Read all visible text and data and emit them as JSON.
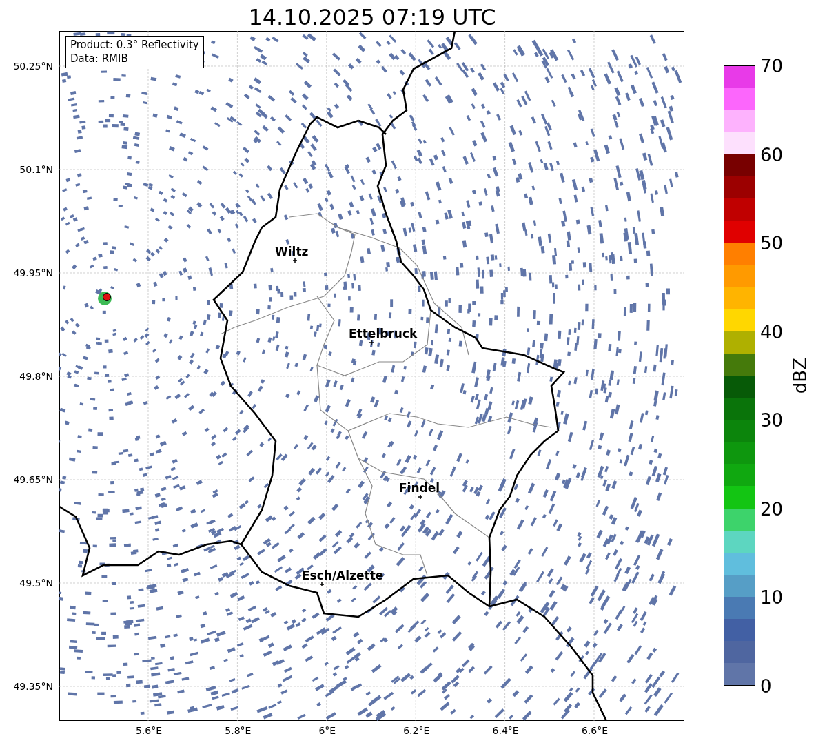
{
  "title": "14.10.2025 07:19 UTC",
  "map": {
    "info_box": [
      "Product: 0.3° Reflectivity",
      "Data: RMIB"
    ],
    "lat_labels": [
      "50.25°N",
      "50.1°N",
      "49.95°N",
      "49.8°N",
      "49.65°N",
      "49.5°N",
      "49.35°N"
    ],
    "lon_labels": [
      "5.6°E",
      "5.8°E",
      "6°E",
      "6.2°E",
      "6.4°E",
      "6.6°E"
    ],
    "places": [
      {
        "name": "Wiltz"
      },
      {
        "name": "Ettelbruck"
      },
      {
        "name": "Findel"
      },
      {
        "name": "Esch/Alzette"
      }
    ]
  },
  "colorbar": {
    "label": "dBZ",
    "ticks": [
      "70",
      "60",
      "50",
      "40",
      "30",
      "20",
      "10",
      "0"
    ],
    "bins": [
      {
        "color": "#e83ae8"
      },
      {
        "color": "#fc66fc"
      },
      {
        "color": "#fdb2fd"
      },
      {
        "color": "#fde0fd"
      },
      {
        "color": "#780000"
      },
      {
        "color": "#9c0000"
      },
      {
        "color": "#c00000"
      },
      {
        "color": "#e00000"
      },
      {
        "color": "#ff7f00"
      },
      {
        "color": "#ff9a00"
      },
      {
        "color": "#ffb400"
      },
      {
        "color": "#ffd700"
      },
      {
        "color": "#afb000"
      },
      {
        "color": "#457a0b"
      },
      {
        "color": "#075a07"
      },
      {
        "color": "#0a740a"
      },
      {
        "color": "#0c850c"
      },
      {
        "color": "#0e970e"
      },
      {
        "color": "#10a810"
      },
      {
        "color": "#13c513"
      },
      {
        "color": "#3dd36b"
      },
      {
        "color": "#5dd6c0"
      },
      {
        "color": "#60bedd"
      },
      {
        "color": "#569ec6"
      },
      {
        "color": "#4a7ab3"
      },
      {
        "color": "#4260a4"
      },
      {
        "color": "#4f66a0"
      },
      {
        "color": "#6075a8"
      }
    ]
  }
}
